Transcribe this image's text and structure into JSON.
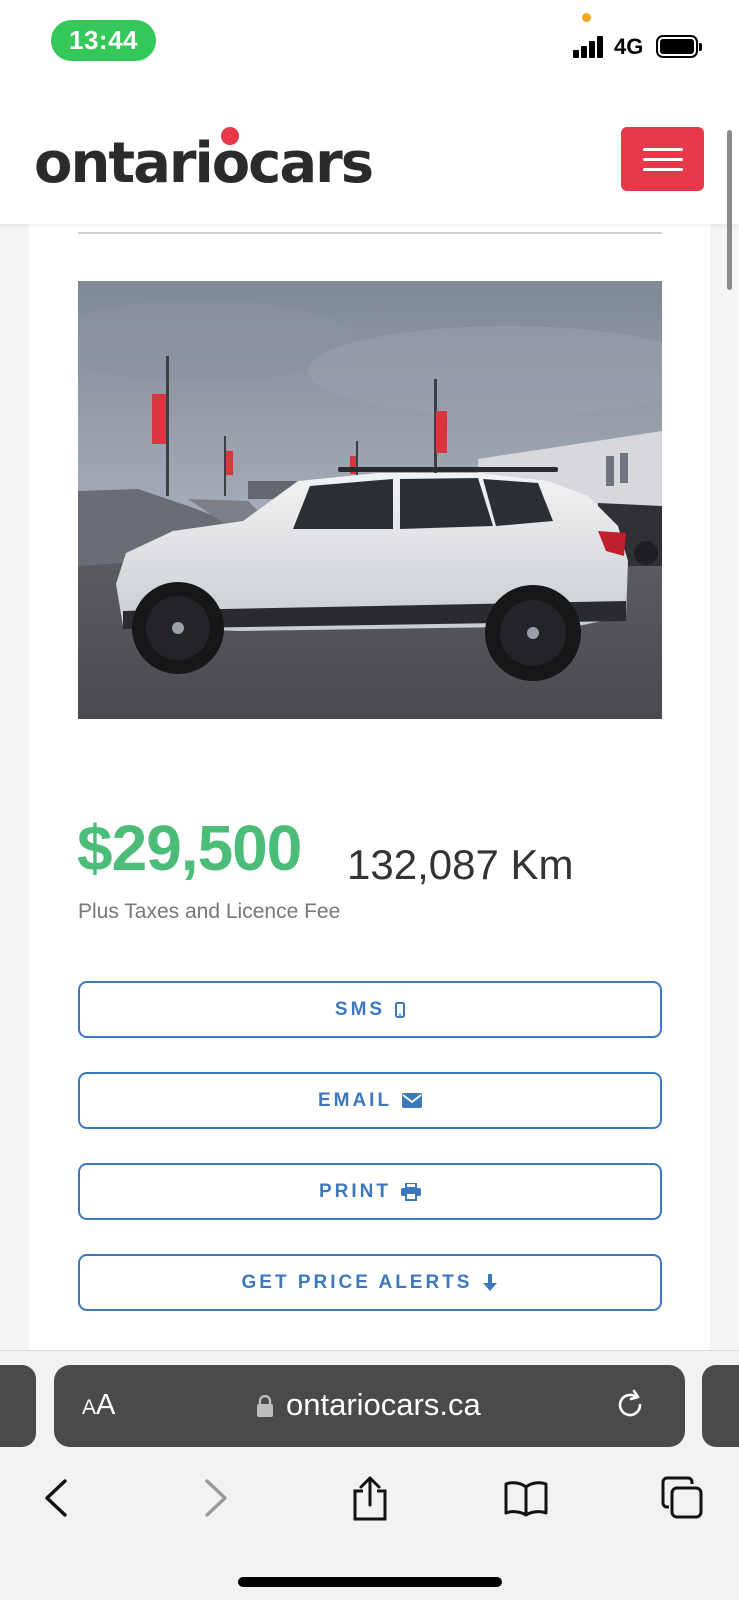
{
  "status_bar": {
    "time": "13:44",
    "network": "4G"
  },
  "header": {
    "logo_text": "ontariocars",
    "menu_icon": "hamburger-icon",
    "accent_color": "#e8394a"
  },
  "listing": {
    "photo_description_icon": "car-photo",
    "price": "$29,500",
    "mileage": "132,087 Km",
    "price_note": "Plus Taxes and Licence Fee",
    "price_color": "#4cbd78"
  },
  "actions": [
    {
      "label": "SMS",
      "icon": "mobile-icon"
    },
    {
      "label": "EMAIL",
      "icon": "envelope-icon"
    },
    {
      "label": "PRINT",
      "icon": "printer-icon"
    },
    {
      "label": "GET PRICE ALERTS",
      "icon": "arrow-down-icon"
    }
  ],
  "browser": {
    "text_size_label_small": "A",
    "text_size_label_large": "A",
    "url": "ontariocars.ca",
    "nav_icons": [
      "back-icon",
      "forward-icon",
      "share-icon",
      "bookmarks-icon",
      "tabs-icon"
    ]
  }
}
